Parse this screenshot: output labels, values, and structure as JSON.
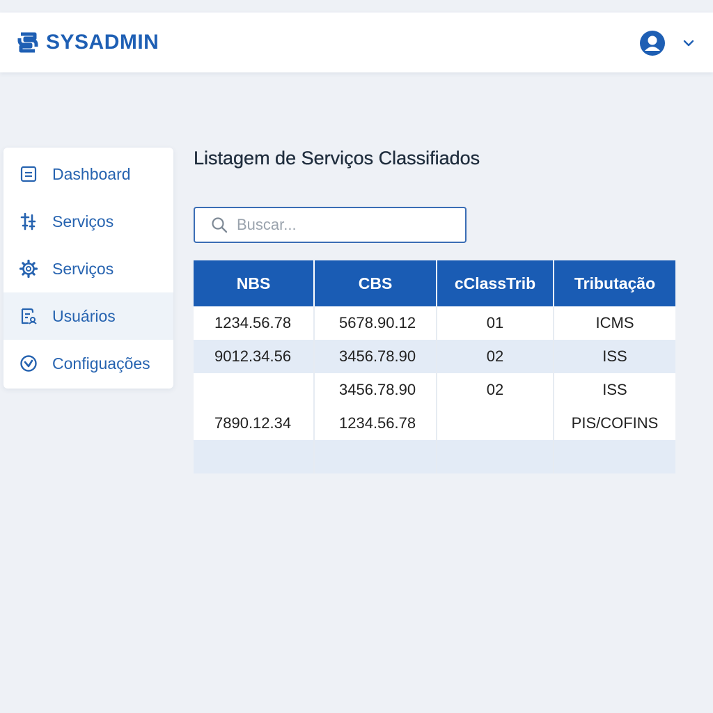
{
  "app": {
    "name": "SYSADMIN"
  },
  "header": {
    "user_icon": "user-circle-icon",
    "menu_icon": "chevron-down-icon"
  },
  "sidebar": {
    "items": [
      {
        "label": "Dashboard",
        "icon": "dashboard-icon"
      },
      {
        "label": "Serviços",
        "icon": "services-icon"
      },
      {
        "label": "Serviços",
        "icon": "gear-icon"
      },
      {
        "label": "Usuários",
        "icon": "users-icon",
        "active": true
      },
      {
        "label": "Configuações",
        "icon": "settings-check-icon"
      }
    ]
  },
  "main": {
    "title": "Listagem de Serviços Classifiados",
    "search": {
      "placeholder": "Buscar...",
      "value": ""
    },
    "table": {
      "columns": [
        "NBS",
        "CBS",
        "cClassTrib",
        "Tributação"
      ],
      "rows": [
        [
          "1234.56.78",
          "5678.90.12",
          "01",
          "ICMS"
        ],
        [
          "9012.34.56",
          "3456.78.90",
          "02",
          "ISS"
        ],
        [
          "",
          "3456.78.90",
          "02",
          "ISS"
        ],
        [
          "7890.12.34",
          "1234.56.78",
          "",
          "PIS/COFINS"
        ],
        [
          "",
          "",
          "",
          ""
        ]
      ]
    }
  },
  "colors": {
    "brand": "#1e5fb4",
    "header_row": "#1a5cb4",
    "striped_row": "#e3ebf6",
    "background": "#eef1f6"
  }
}
